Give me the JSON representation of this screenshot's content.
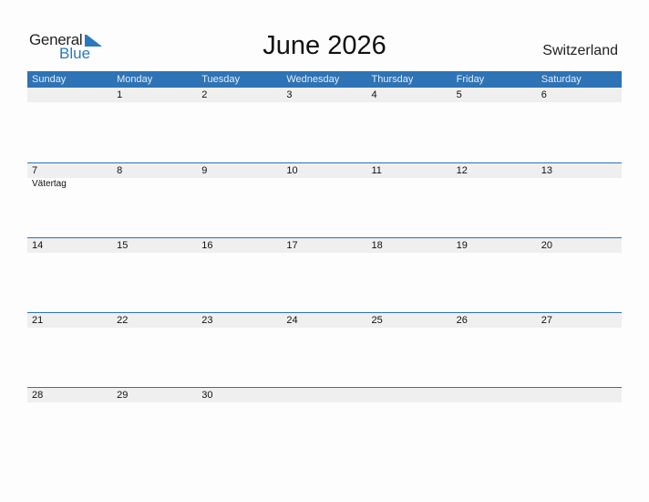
{
  "logo": {
    "general": "General",
    "blue": "Blue"
  },
  "title": "June 2026",
  "country": "Switzerland",
  "colors": {
    "header": "#2e73b5",
    "row": "#efefef"
  },
  "weekdays": [
    "Sunday",
    "Monday",
    "Tuesday",
    "Wednesday",
    "Thursday",
    "Friday",
    "Saturday"
  ],
  "weeks": [
    {
      "days": [
        "",
        "1",
        "2",
        "3",
        "4",
        "5",
        "6"
      ],
      "events": [
        "",
        "",
        "",
        "",
        "",
        "",
        ""
      ]
    },
    {
      "days": [
        "7",
        "8",
        "9",
        "10",
        "11",
        "12",
        "13"
      ],
      "events": [
        "Vätertag",
        "",
        "",
        "",
        "",
        "",
        ""
      ]
    },
    {
      "days": [
        "14",
        "15",
        "16",
        "17",
        "18",
        "19",
        "20"
      ],
      "events": [
        "",
        "",
        "",
        "",
        "",
        "",
        ""
      ]
    },
    {
      "days": [
        "21",
        "22",
        "23",
        "24",
        "25",
        "26",
        "27"
      ],
      "events": [
        "",
        "",
        "",
        "",
        "",
        "",
        ""
      ]
    },
    {
      "days": [
        "28",
        "29",
        "30",
        "",
        "",
        "",
        ""
      ],
      "events": [
        "",
        "",
        "",
        "",
        "",
        "",
        ""
      ]
    }
  ]
}
